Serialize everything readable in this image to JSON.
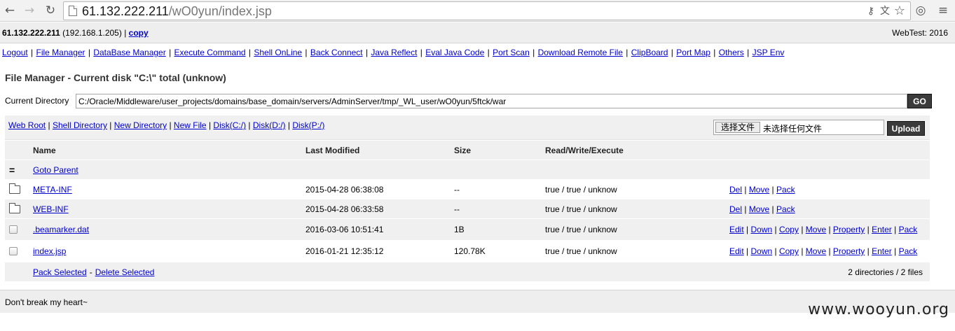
{
  "browser": {
    "url_host": "61.132.222.211",
    "url_path": "/wO0yun/index.jsp"
  },
  "infobar": {
    "host_ip": "61.132.222.211",
    "local_ip": "(192.168.1.205)",
    "separator": "|",
    "copy_label": "copy",
    "brand": "WebTest: 2016"
  },
  "menu": {
    "items": [
      "Logout",
      "File Manager",
      "DataBase Manager",
      "Execute Command",
      "Shell OnLine",
      "Back Connect",
      "Java Reflect",
      "Eval Java Code",
      "Port Scan",
      "Download Remote File",
      "ClipBoard",
      "Port Map",
      "Others",
      "JSP Env"
    ]
  },
  "file_manager": {
    "title": "File Manager - Current disk \"C:\\\" total (unknow)",
    "current_directory_label": "Current Directory",
    "current_directory_value": "C:/Oracle/Middleware/user_projects/domains/base_domain/servers/AdminServer/tmp/_WL_user/wO0yun/5ftck/war",
    "go_label": "GO",
    "shortcuts": [
      "Web Root",
      "Shell Directory",
      "New Directory",
      "New File",
      "Disk(C:/)",
      "Disk(D:/)",
      "Disk(P:/)"
    ],
    "choose_file_label": "选择文件",
    "no_file_label": "未选择任何文件",
    "upload_label": "Upload"
  },
  "table": {
    "headers": {
      "name": "Name",
      "modified": "Last Modified",
      "size": "Size",
      "rwx": "Read/Write/Execute"
    },
    "parent_label": "Goto Parent",
    "rows": [
      {
        "type": "folder",
        "name": "META-INF",
        "modified": "2015-04-28 06:38:08",
        "size": "--",
        "rwx": "true / true / unknow",
        "actions": [
          "Del",
          "Move",
          "Pack"
        ]
      },
      {
        "type": "folder",
        "name": "WEB-INF",
        "modified": "2015-04-28 06:33:58",
        "size": "--",
        "rwx": "true / true / unknow",
        "actions": [
          "Del",
          "Move",
          "Pack"
        ]
      },
      {
        "type": "file",
        "name": ".beamarker.dat",
        "modified": "2016-03-06 10:51:41",
        "size": "1B",
        "rwx": "true / true / unknow",
        "actions": [
          "Edit",
          "Down",
          "Copy",
          "Move",
          "Property",
          "Enter",
          "Pack"
        ]
      },
      {
        "type": "file",
        "name": "index.jsp",
        "modified": "2016-01-21 12:35:12",
        "size": "120.78K",
        "rwx": "true / true / unknow",
        "actions": [
          "Edit",
          "Down",
          "Copy",
          "Move",
          "Property",
          "Enter",
          "Pack"
        ]
      }
    ],
    "pack_selected_label": "Pack Selected",
    "delete_selected_label": "Delete Selected",
    "bulk_separator": "-",
    "summary": "2 directories / 2 files"
  },
  "footer_text": "Don't break my heart~",
  "watermark": "www.wooyun.org"
}
